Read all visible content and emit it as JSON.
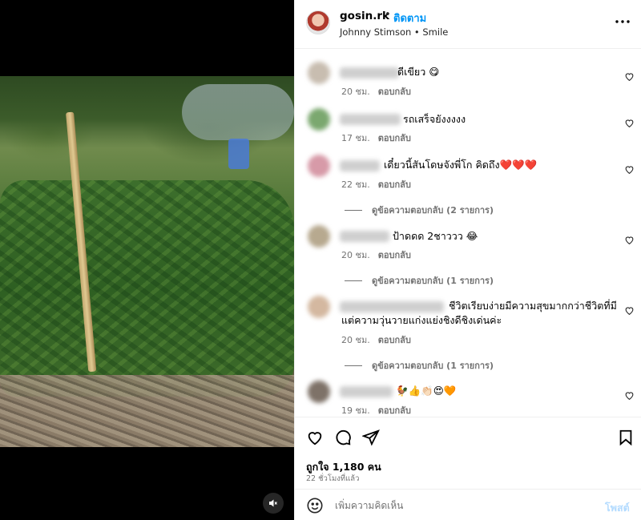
{
  "post": {
    "username": "gosin.rk",
    "separator": "•",
    "follow_label": "ติดตาม",
    "audio": "Johnny Stimson • Smile",
    "more_icon": "more-horizontal-icon"
  },
  "comments": [
    {
      "text": "ดีเขียว 😋",
      "time": "20 ชม.",
      "reply": "ตอบกลับ"
    },
    {
      "text": "รถเสร็จยังงงงง",
      "time": "17 ชม.",
      "reply": "ตอบกลับ"
    },
    {
      "text": "เดี๋ยวนี้สันโดษจังพี่โก คิดถึง❤️❤️❤️",
      "time": "22 ชม.",
      "reply": "ตอบกลับ",
      "view_replies": "ดูข้อความตอบกลับ (2 รายการ)"
    },
    {
      "text": "ป้าดดด 2ชาววว 😂",
      "time": "20 ชม.",
      "reply": "ตอบกลับ",
      "view_replies": "ดูข้อความตอบกลับ (1 รายการ)"
    },
    {
      "text": "ชีวิตเรียบง่ายมีความสุขมากกว่าชีวิตที่มีแต่ความวุ่นวายแก่งแย่งชิงดีชิงเด่นค่ะ",
      "time": "20 ชม.",
      "reply": "ตอบกลับ",
      "view_replies": "ดูข้อความตอบกลับ (1 รายการ)"
    },
    {
      "text": "🐓👍👏🏻😍🧡",
      "time": "19 ชม.",
      "reply": "ตอบกลับ"
    }
  ],
  "actions": {
    "likes": "ถูกใจ 1,180 คน",
    "time_ago": "22 ชั่วโมงที่แล้ว"
  },
  "add_comment": {
    "placeholder": "เพิ่มความคิดเห็น",
    "post_label": "โพสต์"
  }
}
